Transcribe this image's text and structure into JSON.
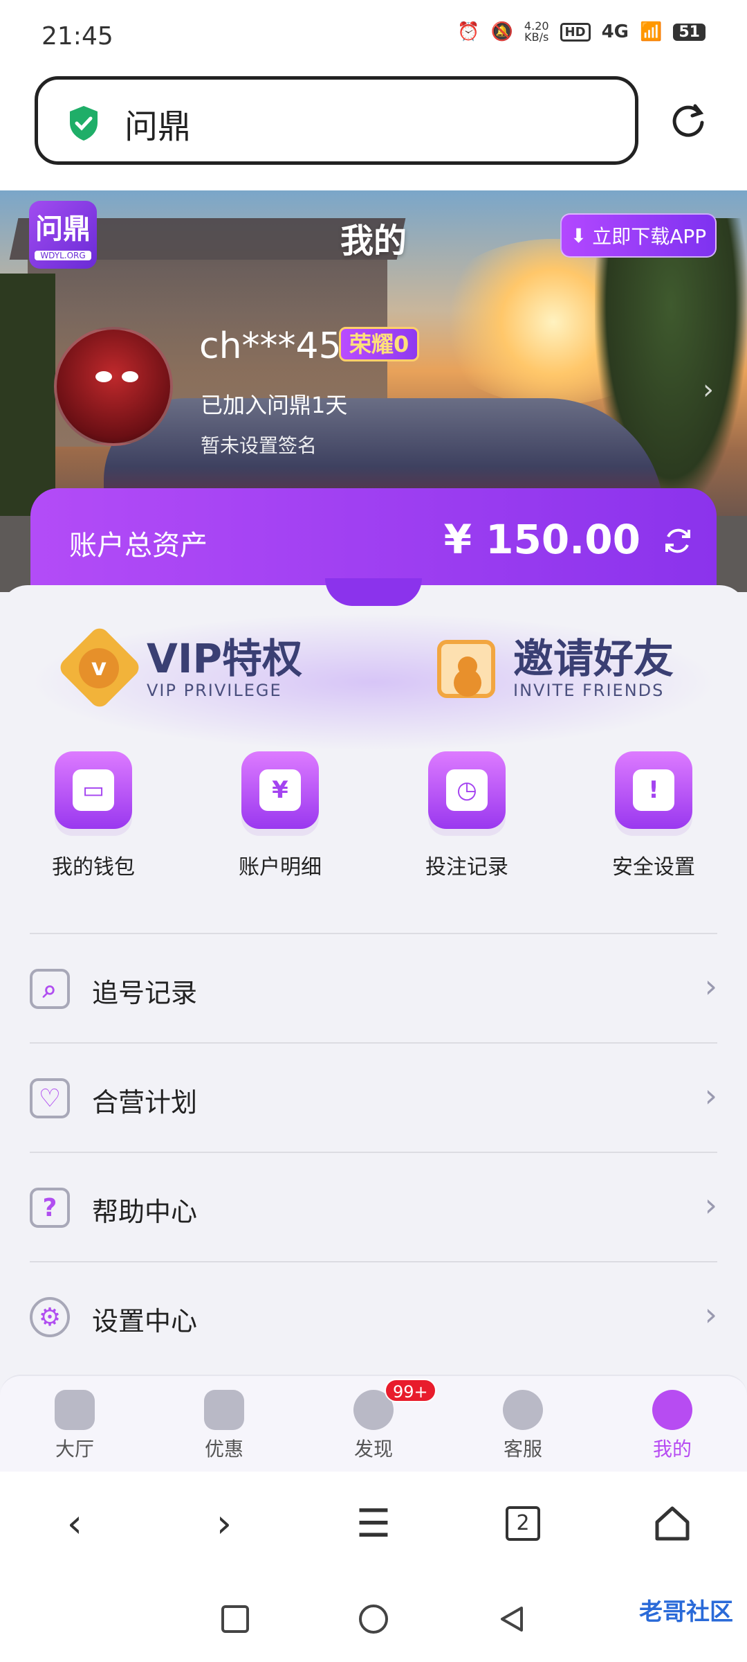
{
  "status": {
    "time": "21:45",
    "speed": "4.20",
    "speed_unit": "KB/s",
    "hd": "HD",
    "network": "4G",
    "battery": "51"
  },
  "browser": {
    "url": "问鼎"
  },
  "header": {
    "logo": "问鼎",
    "logo_sub": "WDYL.ORG",
    "title": "我的",
    "download_label": "立即下载APP"
  },
  "profile": {
    "username": "ch***45",
    "honor": "荣耀0",
    "joined": "已加入问鼎1天",
    "signature": "暂未设置签名"
  },
  "assets": {
    "label": "账户总资产",
    "amount": "¥ 150.00"
  },
  "promos": [
    {
      "title": "VIP特权",
      "subtitle": "VIP PRIVILEGE",
      "icon": "vip-badge-icon"
    },
    {
      "title": "邀请好友",
      "subtitle": "INVITE FRIENDS",
      "icon": "invite-icon"
    }
  ],
  "grid": [
    {
      "label": "我的钱包",
      "icon": "wallet-icon"
    },
    {
      "label": "账户明细",
      "icon": "account-detail-icon"
    },
    {
      "label": "投注记录",
      "icon": "bet-record-icon"
    },
    {
      "label": "安全设置",
      "icon": "shield-icon"
    }
  ],
  "menu": [
    {
      "label": "追号记录",
      "icon": "search-record-icon"
    },
    {
      "label": "合营计划",
      "icon": "partnership-icon"
    },
    {
      "label": "帮助中心",
      "icon": "help-icon"
    },
    {
      "label": "设置中心",
      "icon": "gear-icon"
    }
  ],
  "tabs": [
    {
      "label": "大厅",
      "icon": "home-icon"
    },
    {
      "label": "优惠",
      "icon": "star-icon"
    },
    {
      "label": "发现",
      "icon": "compass-icon",
      "badge": "99+"
    },
    {
      "label": "客服",
      "icon": "support-icon"
    },
    {
      "label": "我的",
      "icon": "user-icon",
      "active": true
    }
  ],
  "browser_tabs_count": "2",
  "watermark": "老哥社区",
  "colors": {
    "accent": "#b74cf2",
    "assets_bg": "#8b33ec",
    "badge": "#e81c2c"
  }
}
